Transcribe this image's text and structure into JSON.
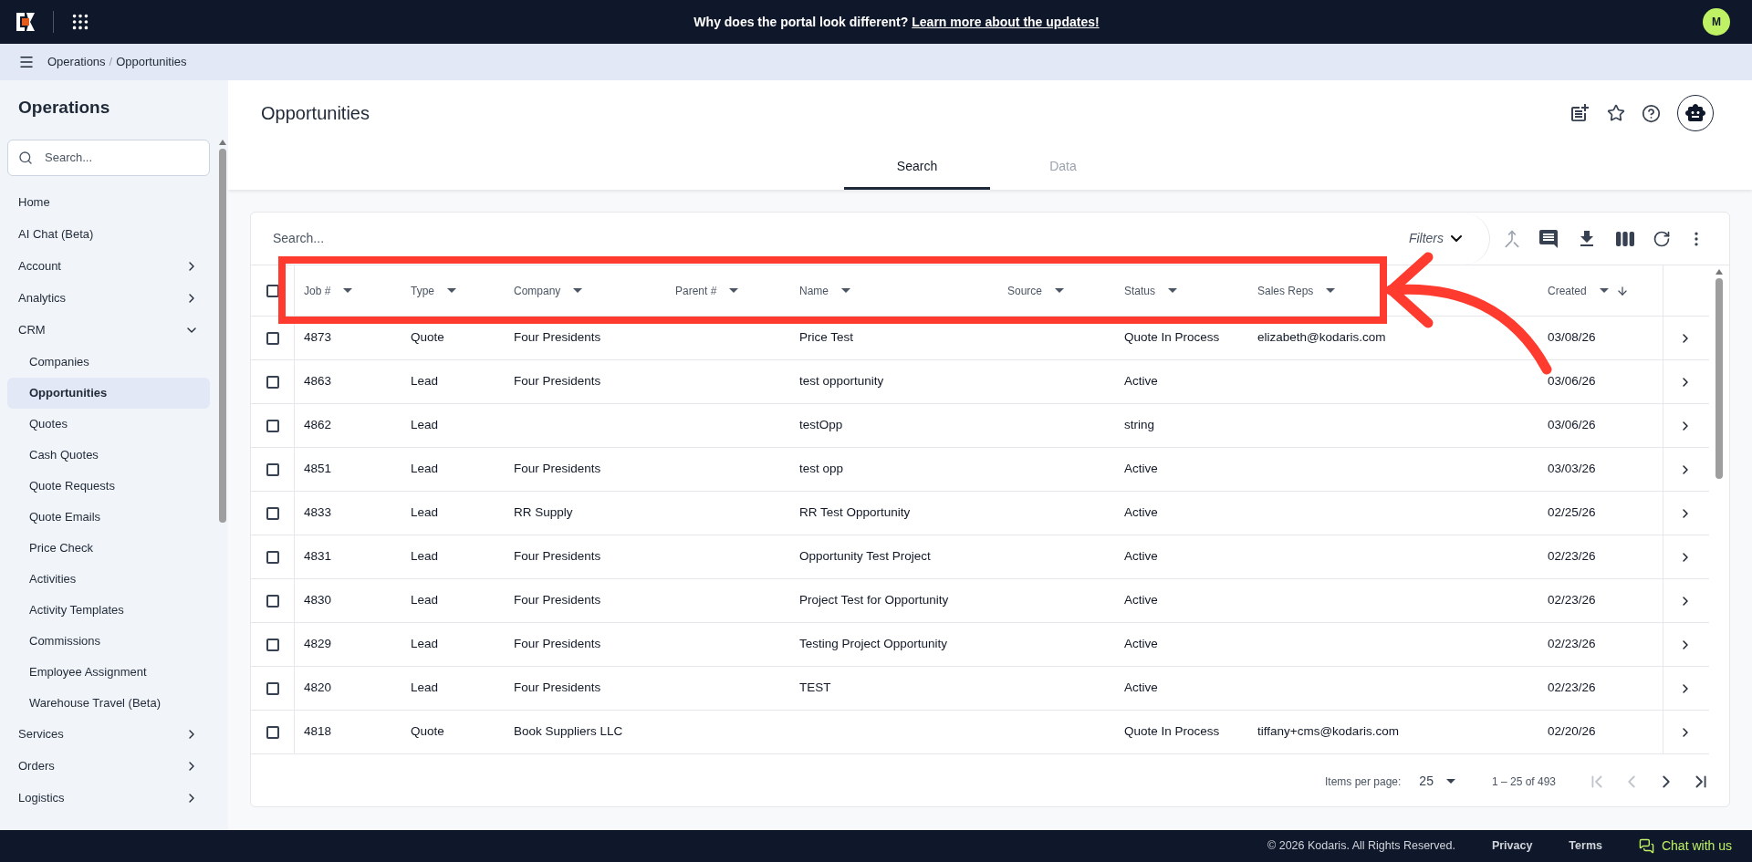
{
  "top_bar": {
    "announcement": "Why does the portal look different?",
    "announcement_link": "Learn more about the updates!",
    "avatar": "M"
  },
  "breadcrumb": [
    "Operations",
    "Opportunities"
  ],
  "breadcrumb_separator": "/",
  "sidebar": {
    "title": "Operations",
    "search_placeholder": "Search...",
    "items": [
      {
        "label": "Home",
        "kind": "link"
      },
      {
        "label": "AI Chat (Beta)",
        "kind": "link"
      },
      {
        "label": "Account",
        "kind": "group",
        "expanded": false
      },
      {
        "label": "Analytics",
        "kind": "group",
        "expanded": false
      },
      {
        "label": "CRM",
        "kind": "group",
        "expanded": true,
        "children": [
          {
            "label": "Companies",
            "selected": false
          },
          {
            "label": "Opportunities",
            "selected": true
          },
          {
            "label": "Quotes",
            "selected": false
          },
          {
            "label": "Cash Quotes",
            "selected": false
          },
          {
            "label": "Quote Requests",
            "selected": false
          },
          {
            "label": "Quote Emails",
            "selected": false
          },
          {
            "label": "Price Check",
            "selected": false
          },
          {
            "label": "Activities",
            "selected": false
          },
          {
            "label": "Activity Templates",
            "selected": false
          },
          {
            "label": "Commissions",
            "selected": false
          },
          {
            "label": "Employee Assignment",
            "selected": false
          },
          {
            "label": "Warehouse Travel (Beta)",
            "selected": false
          }
        ]
      },
      {
        "label": "Services",
        "kind": "group",
        "expanded": false
      },
      {
        "label": "Orders",
        "kind": "group",
        "expanded": false
      },
      {
        "label": "Logistics",
        "kind": "group",
        "expanded": false
      }
    ]
  },
  "page": {
    "title": "Opportunities",
    "tabs": [
      {
        "label": "Search",
        "selected": true
      },
      {
        "label": "Data",
        "selected": false
      }
    ]
  },
  "table": {
    "search_placeholder": "Search...",
    "filters": "Filters",
    "all_checked": false,
    "columns": [
      {
        "label": "Job #",
        "sorted": false
      },
      {
        "label": "Type",
        "sorted": false
      },
      {
        "label": "Company",
        "sorted": false
      },
      {
        "label": "Parent #",
        "sorted": false
      },
      {
        "label": "Name",
        "sorted": false
      },
      {
        "label": "Source",
        "sorted": false
      },
      {
        "label": "Status",
        "sorted": false
      },
      {
        "label": "Sales Reps",
        "sorted": false
      },
      {
        "label": "Created",
        "sorted": true
      }
    ],
    "rows": [
      {
        "checked": false,
        "cells": [
          "4873",
          "Quote",
          "Four Presidents",
          "",
          "Price Test",
          "",
          "Quote In Process",
          "elizabeth@kodaris.com",
          "03/08/26"
        ]
      },
      {
        "checked": false,
        "cells": [
          "4863",
          "Lead",
          "Four Presidents",
          "",
          "test opportunity",
          "",
          "Active",
          "",
          "03/06/26"
        ]
      },
      {
        "checked": false,
        "cells": [
          "4862",
          "Lead",
          "",
          "",
          "testOpp",
          "",
          "string",
          "",
          "03/06/26"
        ]
      },
      {
        "checked": false,
        "cells": [
          "4851",
          "Lead",
          "Four Presidents",
          "",
          "test opp",
          "",
          "Active",
          "",
          "03/03/26"
        ]
      },
      {
        "checked": false,
        "cells": [
          "4833",
          "Lead",
          "RR Supply",
          "",
          "RR Test Opportunity",
          "",
          "Active",
          "",
          "02/25/26"
        ]
      },
      {
        "checked": false,
        "cells": [
          "4831",
          "Lead",
          "Four Presidents",
          "",
          "Opportunity Test Project",
          "",
          "Active",
          "",
          "02/23/26"
        ]
      },
      {
        "checked": false,
        "cells": [
          "4830",
          "Lead",
          "Four Presidents",
          "",
          "Project Test for Opportunity",
          "",
          "Active",
          "",
          "02/23/26"
        ]
      },
      {
        "checked": false,
        "cells": [
          "4829",
          "Lead",
          "Four Presidents",
          "",
          "Testing Project Opportunity",
          "",
          "Active",
          "",
          "02/23/26"
        ]
      },
      {
        "checked": false,
        "cells": [
          "4820",
          "Lead",
          "Four Presidents",
          "",
          "TEST",
          "",
          "Active",
          "",
          "02/23/26"
        ]
      },
      {
        "checked": false,
        "cells": [
          "4818",
          "Quote",
          "Book Suppliers LLC",
          "",
          "",
          "",
          "Quote In Process",
          "tiffany+cms@kodaris.com",
          "02/20/26"
        ]
      }
    ]
  },
  "pagination": {
    "items_per_page_label": "Items per page:",
    "items_per_page": "25",
    "range": "1 – 25 of 493",
    "buttons": [
      {
        "kind": "first",
        "disabled": true
      },
      {
        "kind": "previous",
        "disabled": true
      },
      {
        "kind": "next",
        "disabled": false
      },
      {
        "kind": "last",
        "disabled": false
      }
    ]
  },
  "footer": {
    "copyright": "© 2026 Kodaris. All Rights Reserved.",
    "links": [
      "Privacy",
      "Terms"
    ],
    "chat": "Chat with us"
  }
}
